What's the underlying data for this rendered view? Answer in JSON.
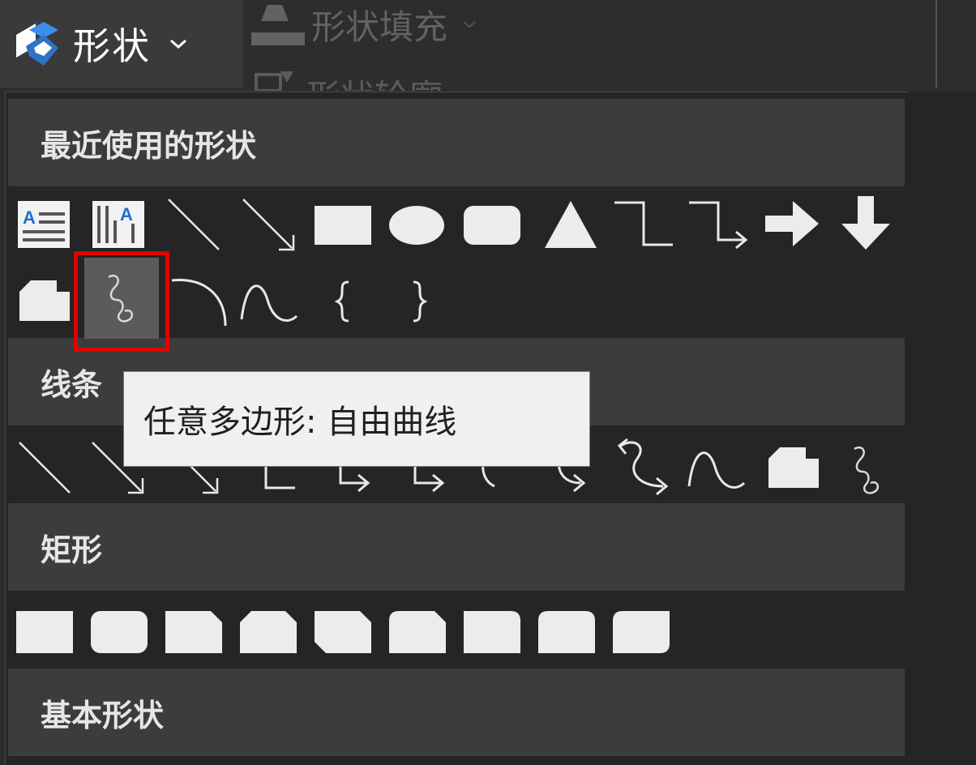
{
  "ribbon": {
    "shapes_label": "形状",
    "fill_label": "形状填充",
    "outline_label": "形状轮廓"
  },
  "panel": {
    "sections": [
      {
        "title": "最近使用的形状"
      },
      {
        "title": "线条"
      },
      {
        "title": "矩形"
      },
      {
        "title": "基本形状"
      }
    ]
  },
  "tooltip": {
    "text": "任意多边形: 自由曲线"
  },
  "colors": {
    "accent_highlight": "#e30000",
    "panel_bg": "#252525",
    "section_bg": "#3c3c3c",
    "icon": "#eaeaea"
  },
  "icons": {
    "recent": [
      "horizontal-text-box-icon",
      "vertical-text-box-icon",
      "line-icon",
      "arrow-line-icon",
      "rectangle-icon",
      "oval-icon",
      "rounded-rectangle-icon",
      "triangle-icon",
      "elbow-connector-icon",
      "elbow-arrow-connector-icon",
      "right-arrow-icon",
      "down-arrow-icon",
      "snip-rectangle-icon",
      "freeform-scribble-icon",
      "arc-icon",
      "curve-icon",
      "left-brace-icon",
      "right-brace-icon"
    ],
    "lines": [
      "line-icon",
      "arrow-line-icon",
      "double-arrow-line-icon",
      "elbow-connector-icon",
      "elbow-arrow-connector-icon",
      "elbow-double-arrow-connector-icon",
      "curved-connector-icon",
      "curved-arrow-connector-icon",
      "curved-double-arrow-connector-icon",
      "curve-icon",
      "freeform-shape-icon",
      "freeform-scribble-icon"
    ],
    "rectangles": [
      "rectangle-icon",
      "rounded-rectangle-icon",
      "snip-single-corner-rectangle-icon",
      "snip-same-side-corner-rectangle-icon",
      "snip-diagonal-corner-rectangle-icon",
      "snip-round-single-corner-rectangle-icon",
      "round-single-corner-rectangle-icon",
      "round-same-side-corner-rectangle-icon",
      "round-diagonal-corner-rectangle-icon"
    ]
  }
}
